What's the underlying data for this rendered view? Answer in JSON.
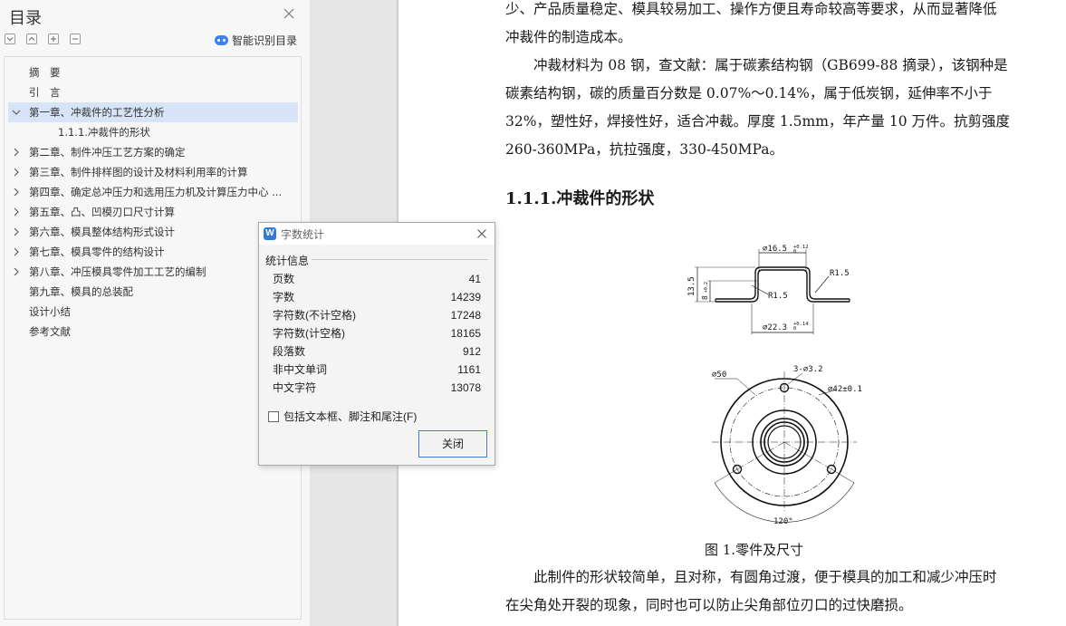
{
  "toc": {
    "title": "目录",
    "smart_label": "智能识别目录",
    "items": [
      {
        "label": "摘　要",
        "expandable": false,
        "expanded": false,
        "selected": false,
        "level": 1
      },
      {
        "label": "引　言",
        "expandable": false,
        "expanded": false,
        "selected": false,
        "level": 1
      },
      {
        "label": "第一章、冲裁件的工艺性分析",
        "expandable": true,
        "expanded": true,
        "selected": true,
        "level": 1
      },
      {
        "label": "1.1.1.冲裁件的形状",
        "expandable": false,
        "expanded": false,
        "selected": false,
        "level": 2
      },
      {
        "label": "第二章、制件冲压工艺方案的确定",
        "expandable": true,
        "expanded": false,
        "selected": false,
        "level": 1
      },
      {
        "label": "第三章、制件排样图的设计及材料利用率的计算",
        "expandable": true,
        "expanded": false,
        "selected": false,
        "level": 1
      },
      {
        "label": "第四章、确定总冲压力和选用压力机及计算压力中心 ...",
        "expandable": true,
        "expanded": false,
        "selected": false,
        "level": 1
      },
      {
        "label": "第五章、凸、凹模刃口尺寸计算",
        "expandable": true,
        "expanded": false,
        "selected": false,
        "level": 1
      },
      {
        "label": "第六章、模具整体结构形式设计",
        "expandable": true,
        "expanded": false,
        "selected": false,
        "level": 1
      },
      {
        "label": "第七章、模具零件的结构设计",
        "expandable": true,
        "expanded": false,
        "selected": false,
        "level": 1
      },
      {
        "label": "第八章、冲压模具零件加工工艺的编制",
        "expandable": true,
        "expanded": false,
        "selected": false,
        "level": 1
      },
      {
        "label": "第九章、模具的总装配",
        "expandable": false,
        "expanded": false,
        "selected": false,
        "level": 1
      },
      {
        "label": "设计小结",
        "expandable": false,
        "expanded": false,
        "selected": false,
        "level": 1
      },
      {
        "label": "参考文献",
        "expandable": false,
        "expanded": false,
        "selected": false,
        "level": 1
      }
    ]
  },
  "document": {
    "lines": [
      "少、产品质量稳定、模具较易加工、操作方便且寿命较高等要求，从而显著降低",
      "冲裁件的制造成本。",
      "　　冲裁材料为 08 钢，查文献：属于碳素结构钢（GB699-88 摘录），该钢种是",
      "碳素结构钢，碳的质量百分数是 0.07%～0.14%，属于低炭钢，延伸率不小于",
      "32%，塑性好，焊接性好，适合冲裁。厚度 1.5mm，年产量 10 万件。抗剪强度",
      "260-360MPa，抗拉强度，330-450MPa。"
    ],
    "heading": "1.1.1.冲裁件的形状",
    "figure_top_labels": {
      "d_top": "⌀16.5",
      "d_top_tol": "+0.12",
      "d_top_tol_low": "0",
      "r_right": "R1.5",
      "r_left": "R1.5",
      "h_total": "13.5",
      "h_inner": "8",
      "h_inner_tol": "+0.2",
      "d_bottom": "⌀22.3",
      "d_bottom_tol": "+0.14",
      "d_bottom_tol_low": "0"
    },
    "figure_bottom_labels": {
      "d_outer": "⌀50",
      "holes": "3-⌀3.2",
      "pcd": "⌀42±0.1",
      "angle": "120°"
    },
    "caption": "图 1.零件及尺寸",
    "after_lines": [
      "　　此制件的形状较简单，且对称，有圆角过渡，便于模具的加工和减少冲压时",
      "在尖角处开裂的现象，同时也可以防止尖角部位刃口的过快磨损。"
    ]
  },
  "dialog": {
    "logo": "W",
    "title": "字数统计",
    "group_label": "统计信息",
    "stats": [
      {
        "label": "页数",
        "value": "41"
      },
      {
        "label": "字数",
        "value": "14239"
      },
      {
        "label": "字符数(不计空格)",
        "value": "17248"
      },
      {
        "label": "字符数(计空格)",
        "value": "18165"
      },
      {
        "label": "段落数",
        "value": "912"
      },
      {
        "label": "非中文单词",
        "value": "1161"
      },
      {
        "label": "中文字符",
        "value": "13078"
      }
    ],
    "checkbox_label": "包括文本框、脚注和尾注(F)",
    "checkbox_checked": false,
    "close_label": "关闭"
  },
  "colors": {
    "selection": "#d7e3f6",
    "accent": "#3c7bd3",
    "panel_bg": "#f7f7f7"
  }
}
